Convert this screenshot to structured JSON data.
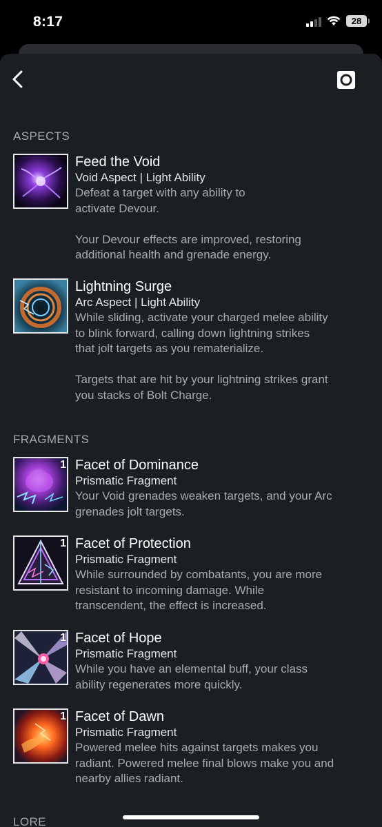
{
  "status_bar": {
    "time": "8:17",
    "battery": "28"
  },
  "sections": {
    "aspects": "ASPECTS",
    "fragments": "FRAGMENTS",
    "lore": "LORE"
  },
  "aspects": [
    {
      "title": "Feed the Void",
      "subtitle": "Void Aspect | Light Ability",
      "description": "Defeat a target with any ability to\nactivate Devour.\n\nYour Devour effects are improved, restoring\nadditional health and grenade energy.",
      "icon": "void-aspect-icon"
    },
    {
      "title": "Lightning Surge",
      "subtitle": "Arc Aspect | Light Ability",
      "description": "While sliding, activate your charged melee ability\nto blink forward, calling down lightning strikes\nthat jolt targets as you rematerialize.\n\nTargets that are hit by your lightning strikes grant\nyou stacks of Bolt Charge.",
      "icon": "arc-aspect-icon"
    }
  ],
  "fragments": [
    {
      "title": "Facet of Dominance",
      "subtitle": "Prismatic Fragment",
      "description": "Your Void grenades weaken targets, and your Arc\ngrenades jolt targets.",
      "badge": "1",
      "icon": "dominance-fragment-icon"
    },
    {
      "title": "Facet of Protection",
      "subtitle": "Prismatic Fragment",
      "description": "While surrounded by combatants, you are more\nresistant to incoming damage. While\ntranscendent, the effect is increased.",
      "badge": "1",
      "icon": "protection-fragment-icon"
    },
    {
      "title": "Facet of Hope",
      "subtitle": "Prismatic Fragment",
      "description": "While you have an elemental buff, your class\nability regenerates more quickly.",
      "badge": "1",
      "icon": "hope-fragment-icon"
    },
    {
      "title": "Facet of Dawn",
      "subtitle": "Prismatic Fragment",
      "description": "Powered melee hits against targets makes you\nradiant. Powered melee final blows make you and\nnearby allies radiant.",
      "badge": "1",
      "icon": "dawn-fragment-icon"
    }
  ],
  "colors": {
    "background": "#000000",
    "sheet": "#1b1e22",
    "section_header": "#a7a9ad",
    "description": "#a9abaf",
    "thumb_border": "#e9e9e9"
  }
}
